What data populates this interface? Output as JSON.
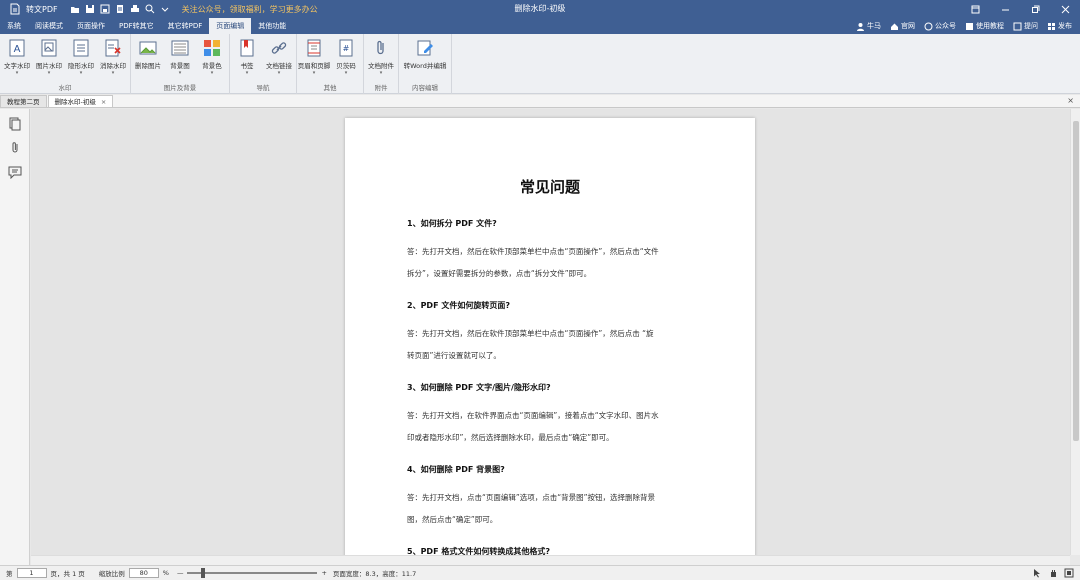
{
  "app": {
    "name": "转文PDF",
    "promo": "关注公众号，领取福利，学习更多办公",
    "window_title": "删除水印-初级"
  },
  "menu": {
    "items": [
      "系统",
      "阅读模式",
      "页面操作",
      "PDF转其它",
      "其它转PDF",
      "页面编辑",
      "其他功能"
    ],
    "active_index": 5,
    "right": [
      "牛马",
      "官网",
      "公众号",
      "使用教程",
      "提问",
      "发布"
    ]
  },
  "ribbon": {
    "groups": [
      {
        "label": "水印",
        "buttons": [
          "文字水印",
          "图片水印",
          "隐形水印",
          "消除水印"
        ]
      },
      {
        "label": "图片及背景",
        "buttons": [
          "删除图片",
          "背景图",
          "背景色"
        ]
      },
      {
        "label": "导航",
        "buttons": [
          "书签",
          "文档链接"
        ]
      },
      {
        "label": "其他",
        "buttons": [
          "页眉和页脚",
          "贝茨码"
        ]
      },
      {
        "label": "附件",
        "buttons": [
          "文档附件"
        ]
      },
      {
        "label": "内容编辑",
        "buttons": [
          "转Word并编辑"
        ]
      }
    ]
  },
  "doc_tabs": [
    "教程第二页",
    "删除水印-初级"
  ],
  "page": {
    "title": "常见问题",
    "items": [
      {
        "q": "1、如何拆分 PDF 文件?",
        "a": [
          "答：先打开文档，然后在软件顶部菜单栏中点击“页面操作”，然后点击“文件",
          "拆分”，设置好需要拆分的参数，点击“拆分文件”即可。"
        ]
      },
      {
        "q": "2、PDF 文件如何旋转页面?",
        "a": [
          "答：先打开文档，然后在软件顶部菜单栏中点击“页面操作”，然后点击 “旋",
          "转页面”进行设置就可以了。"
        ]
      },
      {
        "q": "3、如何删除 PDF 文字/图片/隐形水印?",
        "a": [
          "答：先打开文档，在软件界面点击“页面编辑”，接着点击“文字水印、图片水",
          "印或者隐形水印”，然后选择删除水印，最后点击“确定”即可。"
        ]
      },
      {
        "q": "4、如何删除 PDF 背景图?",
        "a": [
          "答：先打开文档，点击“页面编辑”选项，点击“背景图”按钮，选择删除背景",
          "图，然后点击“确定”即可。"
        ]
      },
      {
        "q": "5、PDF 格式文件如何转换成其他格式?",
        "a": []
      }
    ]
  },
  "status": {
    "page_label": "第",
    "page_value": "1",
    "page_total": "页，共 1 页",
    "zoom_label": "缩放比例",
    "zoom_value": "80",
    "zoom_unit": "%",
    "zoom_minus": "—",
    "zoom_plus": "+",
    "page_size": "页面宽度：8.3，高度：11.7"
  },
  "colors": {
    "titlebar": "#3f5f93",
    "promo": "#f6c560"
  }
}
